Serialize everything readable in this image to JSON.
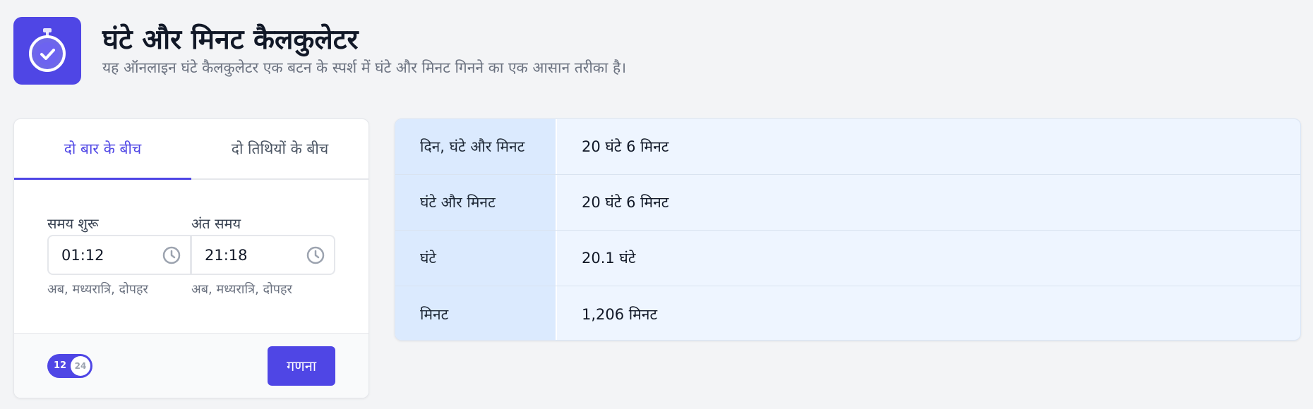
{
  "header": {
    "title": "घंटे और मिनट कैलकुलेटर",
    "subtitle": "यह ऑनलाइन घंटे कैलकुलेटर एक बटन के स्पर्श में घंटे और मिनट गिनने का एक आसान तरीका है।",
    "logo_icon": "stopwatch-check-icon"
  },
  "tabs": [
    {
      "label": "दो बार के बीच",
      "active": true
    },
    {
      "label": "दो तिथियों के बीच",
      "active": false
    }
  ],
  "form": {
    "start": {
      "label": "समय शुरू",
      "value": "01:12",
      "hint": "अब, मध्यरात्रि, दोपहर"
    },
    "end": {
      "label": "अंत समय",
      "value": "21:18",
      "hint": "अब, मध्यरात्रि, दोपहर"
    }
  },
  "footer": {
    "toggle_12": "12",
    "toggle_24": "24",
    "calculate_label": "गणना"
  },
  "results": [
    {
      "label": "दिन, घंटे और मिनट",
      "value": "20 घंटे 6 मिनट"
    },
    {
      "label": "घंटे और मिनट",
      "value": "20 घंटे 6 मिनट"
    },
    {
      "label": "घंटे",
      "value": "20.1 घंटे"
    },
    {
      "label": "मिनट",
      "value": "1,206 मिनट"
    }
  ],
  "colors": {
    "accent": "#4f46e5",
    "background": "#f3f4f6",
    "result_label_bg": "#dbeafe",
    "result_value_bg": "#eef5ff"
  }
}
